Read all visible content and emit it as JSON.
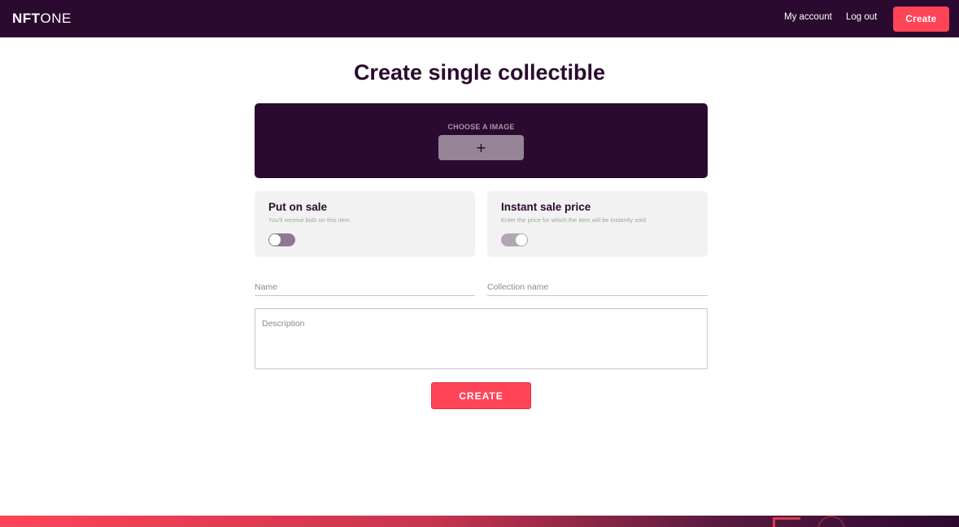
{
  "header": {
    "logo_bold": "NFT",
    "logo_light": "ONE",
    "my_account_label": "My account",
    "logout_label": "Log out",
    "create_label": "Create"
  },
  "page_title": "Create single collectible",
  "upload": {
    "label": "CHOOSE A IMAGE",
    "button_icon": "+"
  },
  "put_on_sale": {
    "title": "Put on sale",
    "subtitle": "You'll receive bids on this item",
    "toggle_on": false
  },
  "instant_sale": {
    "title": "Instant sale price",
    "subtitle": "Enter the price for which the item will be instantly sold",
    "toggle_on": true
  },
  "form": {
    "name_placeholder": "Name",
    "name_value": "",
    "collection_placeholder": "Collection name",
    "collection_value": "",
    "description_placeholder": "Description",
    "description_value": ""
  },
  "submit_label": "CREATE",
  "colors": {
    "brand_dark": "#2a0a2e",
    "accent": "#ff4458",
    "card_bg": "#f2f2f2"
  },
  "icons": [
    "plus-icon",
    "toggle-switch"
  ]
}
